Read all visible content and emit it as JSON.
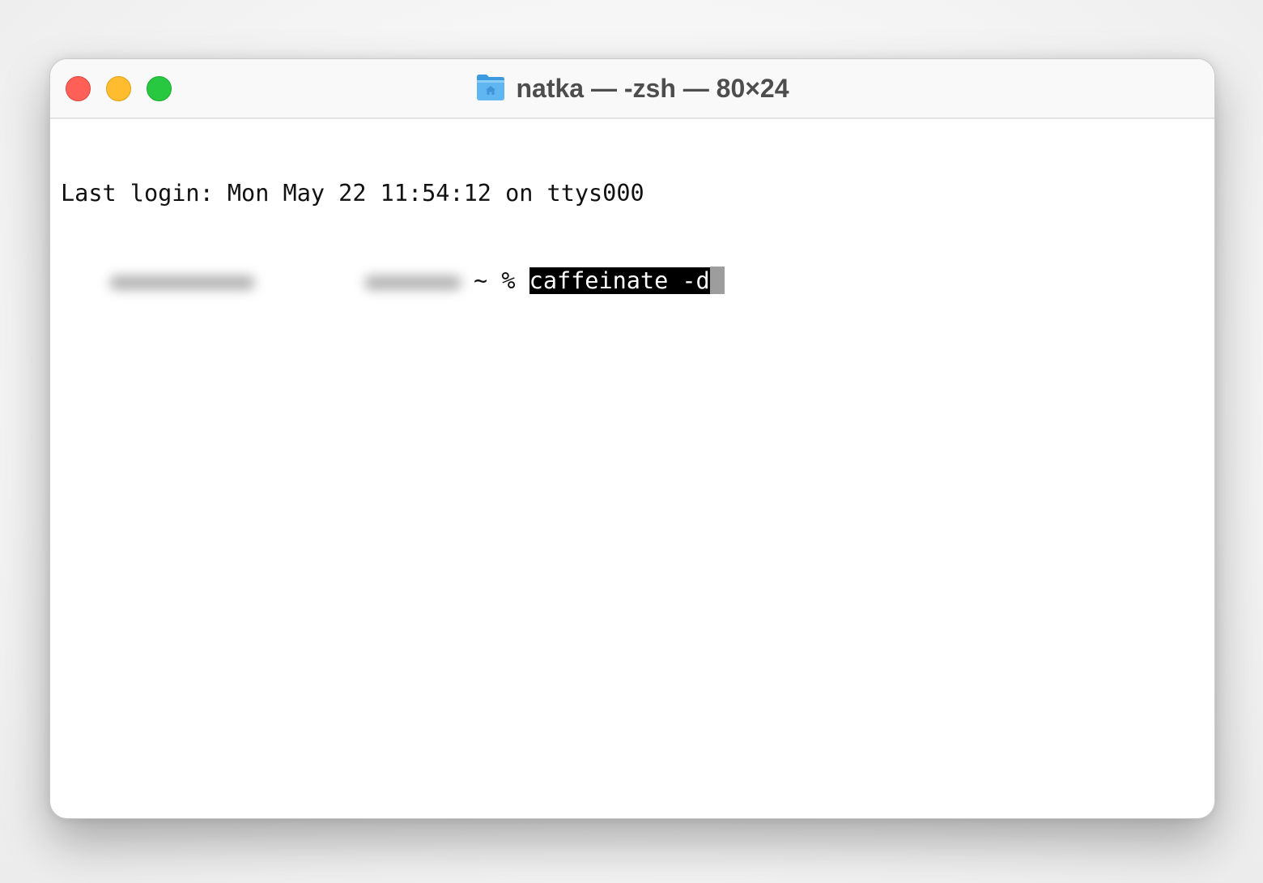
{
  "window": {
    "title": "natka — -zsh — 80×24",
    "title_icon": "home-folder-icon",
    "traffic_lights": {
      "close_color": "#fe5f57",
      "minimize_color": "#febc2e",
      "maximize_color": "#28c840"
    }
  },
  "terminal": {
    "lines": [
      "Last login: Mon May 22 11:54:12 on ttys000"
    ],
    "prompt_symbol": "~ %",
    "command": "caffeinate -d",
    "redacted_prefix": "[blurred hostname]"
  }
}
